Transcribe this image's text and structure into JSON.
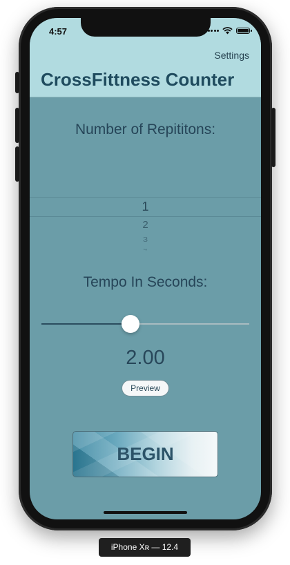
{
  "status_bar": {
    "time": "4:57"
  },
  "nav": {
    "settings_label": "Settings",
    "title": "CrossFittness Counter"
  },
  "repetitions": {
    "label": "Number of Repititons:",
    "picker_items": [
      "1",
      "2",
      "3",
      "4"
    ],
    "selected": "1"
  },
  "tempo": {
    "label": "Tempo In Seconds:",
    "slider_value": 0.43,
    "value_text": "2.00",
    "preview_label": "Preview"
  },
  "begin_label": "BEGIN",
  "device_label": "iPhone Xʀ — 12.4",
  "colors": {
    "header_bg": "#b1dbe0",
    "content_bg": "#6b9da8",
    "title": "#1f4b5e"
  }
}
